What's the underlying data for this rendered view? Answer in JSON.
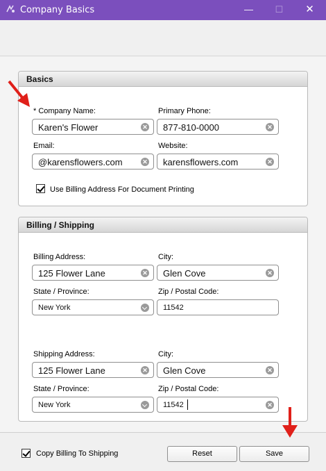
{
  "window": {
    "title": "Company Basics",
    "minimize_glyph": "—",
    "maximize_glyph": "☐",
    "close_glyph": "✕"
  },
  "basics": {
    "header": "Basics",
    "company_name_label": "* Company Name:",
    "company_name_value": "Karen's Flower",
    "primary_phone_label": "Primary Phone:",
    "primary_phone_value": "877-810-0000",
    "email_label": "Email:",
    "email_value": "@karensflowers.com",
    "website_label": "Website:",
    "website_value": "karensflowers.com",
    "use_billing_label": "Use Billing Address For Document Printing",
    "use_billing_checked": true
  },
  "billing_shipping": {
    "header": "Billing / Shipping",
    "billing": {
      "address_label": "Billing Address:",
      "address_value": "125 Flower Lane",
      "city_label": "City:",
      "city_value": "Glen Cove",
      "state_label": "State / Province:",
      "state_value": "New York",
      "zip_label": "Zip / Postal Code:",
      "zip_value": "11542"
    },
    "shipping": {
      "address_label": "Shipping Address:",
      "address_value": "125 Flower Lane",
      "city_label": "City:",
      "city_value": "Glen Cove",
      "state_label": "State / Province:",
      "state_value": "New York",
      "zip_label": "Zip / Postal Code:",
      "zip_value": "11542"
    }
  },
  "footer": {
    "copy_billing_label": "Copy Billing To Shipping",
    "copy_billing_checked": true,
    "reset_label": "Reset",
    "save_label": "Save"
  },
  "clear_glyph": "✕",
  "colors": {
    "titlebar": "#7b4fbd",
    "annotation_arrow": "#e0201a"
  }
}
